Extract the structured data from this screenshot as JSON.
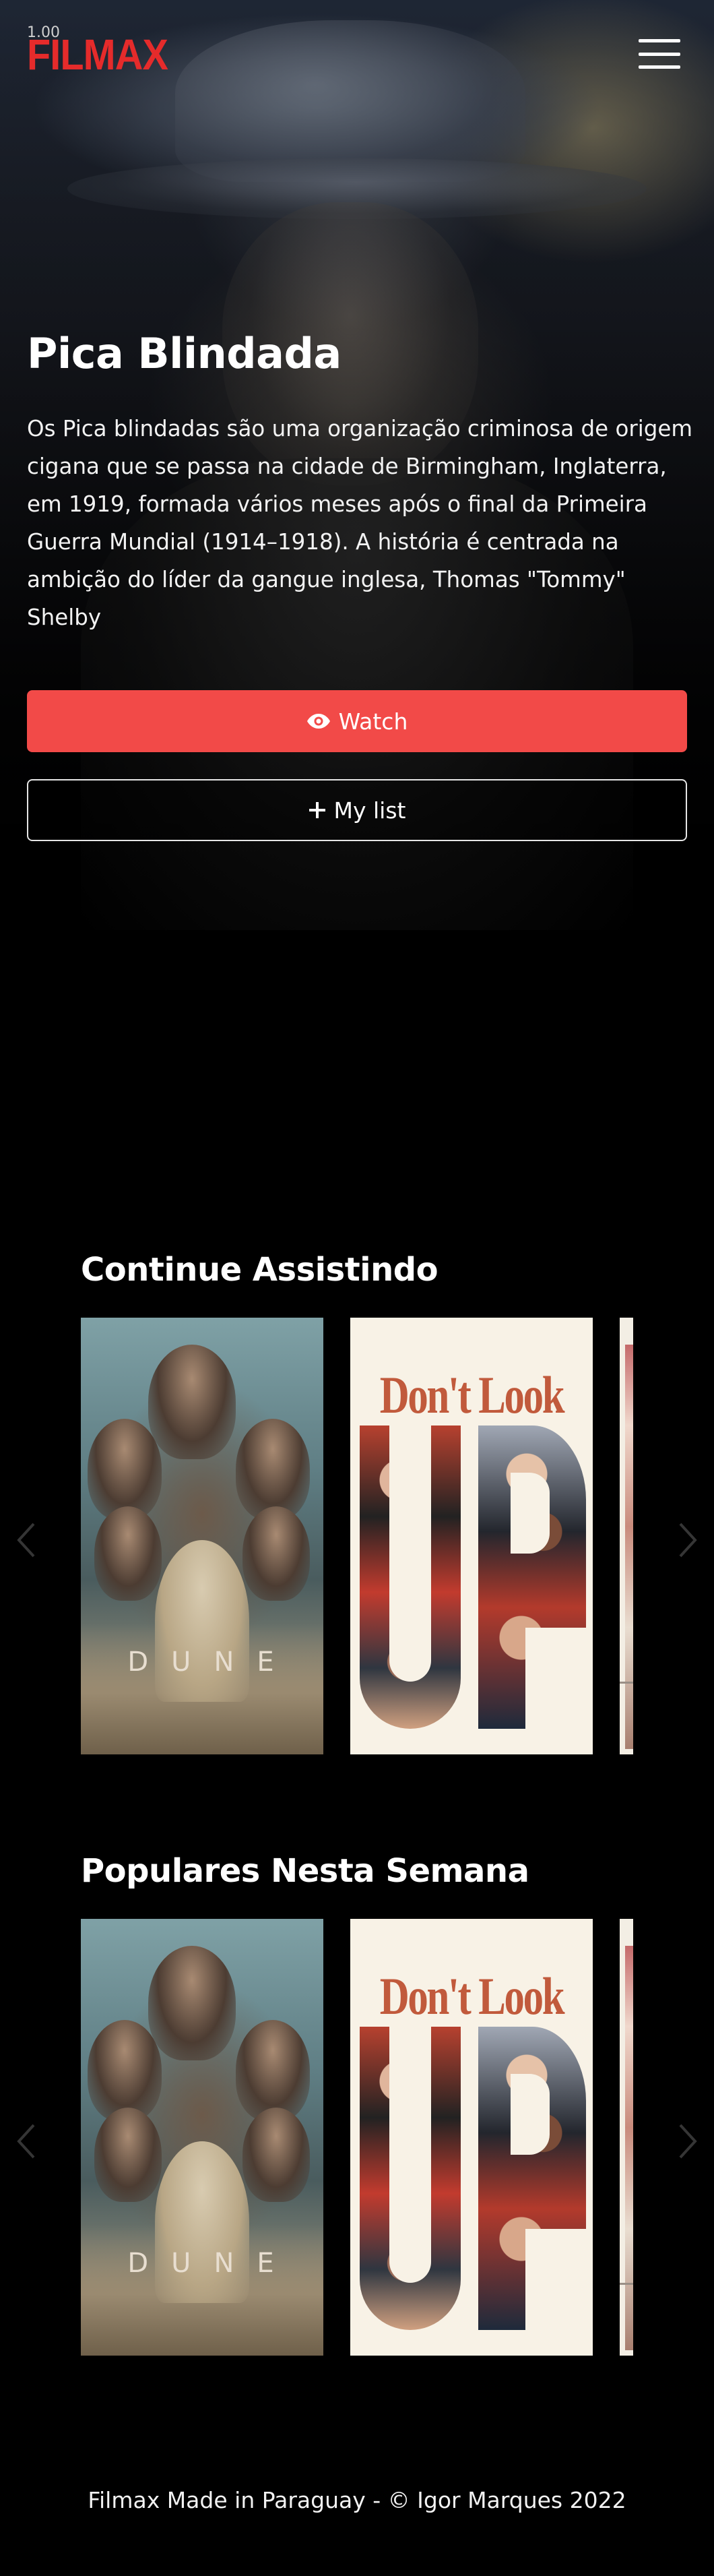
{
  "status": {
    "fps": "1.00"
  },
  "header": {
    "logo": "FILMAX",
    "menu_icon": "hamburger-menu-icon"
  },
  "hero": {
    "title": "Pica Blindada",
    "description": "Os Pica blindadas são uma organização criminosa de origem cigana que se passa na cidade de Birmingham, Inglaterra, em 1919, formada vários meses após o final da Primeira Guerra Mundial (1914–1918). A história é centrada na ambição do líder da gangue inglesa, Thomas \"Tommy\" Shelby",
    "watch_label": "Watch",
    "watch_icon": "eye-icon",
    "mylist_label": "My list",
    "mylist_icon": "plus-icon",
    "accent_color": "#f24a48"
  },
  "rows": [
    {
      "title": "Continue Assistindo",
      "posters": [
        {
          "id": "dune",
          "title_text": "DUNE"
        },
        {
          "id": "dont-look-up",
          "title_text": "Don't Look",
          "title_big": "UP"
        },
        {
          "id": "partial"
        }
      ]
    },
    {
      "title": "Populares Nesta Semana",
      "posters": [
        {
          "id": "dune",
          "title_text": "DUNE"
        },
        {
          "id": "dont-look-up",
          "title_text": "Don't Look",
          "title_big": "UP"
        },
        {
          "id": "partial"
        }
      ]
    }
  ],
  "footer": {
    "text": "Filmax Made in Paraguay - © Igor Marques 2022"
  }
}
